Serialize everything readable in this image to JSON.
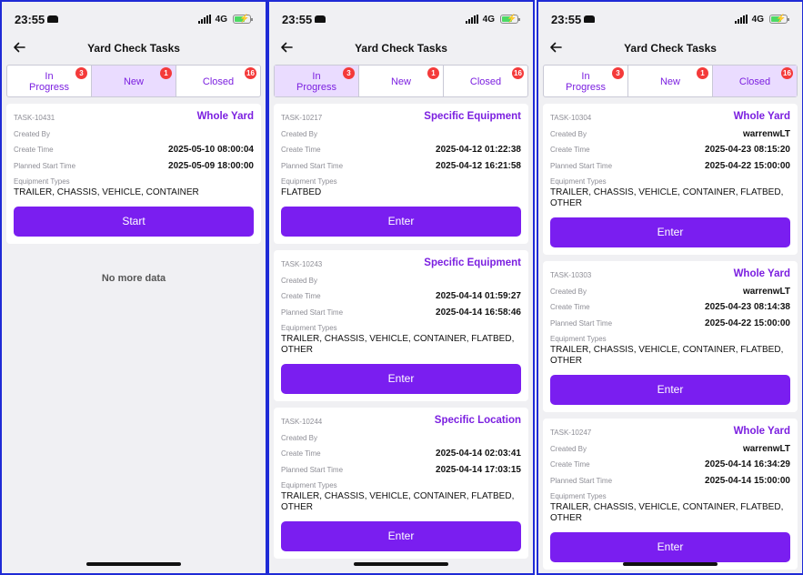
{
  "colors": {
    "accent": "#7a1ef0",
    "badge": "#f43a3a",
    "active_tab_bg": "#eadcff",
    "frame": "#1f2bd6"
  },
  "screens": [
    {
      "status": {
        "time": "23:55",
        "network": "4G"
      },
      "header": {
        "title": "Yard Check Tasks",
        "back_icon": "arrow-left-icon"
      },
      "tabs": [
        {
          "label": "In\nProgress",
          "badge": "3",
          "active": false
        },
        {
          "label": "New",
          "badge": "1",
          "active": true
        },
        {
          "label": "Closed",
          "badge": "16",
          "active": false
        }
      ],
      "tasks": [
        {
          "id": "TASK-10431",
          "kind": "Whole Yard",
          "created_by_label": "Created By",
          "created_by": "",
          "create_time_label": "Create Time",
          "create_time": "2025-05-10 08:00:04",
          "planned_label": "Planned Start Time",
          "planned": "2025-05-09 18:00:00",
          "types_label": "Equipment Types",
          "types": "TRAILER, CHASSIS, VEHICLE, CONTAINER",
          "button": "Start"
        }
      ],
      "footer": "No more data"
    },
    {
      "status": {
        "time": "23:55",
        "network": "4G"
      },
      "header": {
        "title": "Yard Check Tasks",
        "back_icon": "arrow-left-icon"
      },
      "tabs": [
        {
          "label": "In\nProgress",
          "badge": "3",
          "active": true
        },
        {
          "label": "New",
          "badge": "1",
          "active": false
        },
        {
          "label": "Closed",
          "badge": "16",
          "active": false
        }
      ],
      "tasks": [
        {
          "id": "TASK-10217",
          "kind": "Specific Equipment",
          "created_by_label": "Created By",
          "created_by": "",
          "create_time_label": "Create Time",
          "create_time": "2025-04-12 01:22:38",
          "planned_label": "Planned Start Time",
          "planned": "2025-04-12 16:21:58",
          "types_label": "Equipment Types",
          "types": "FLATBED",
          "button": "Enter"
        },
        {
          "id": "TASK-10243",
          "kind": "Specific Equipment",
          "created_by_label": "Created By",
          "created_by": "",
          "create_time_label": "Create Time",
          "create_time": "2025-04-14 01:59:27",
          "planned_label": "Planned Start Time",
          "planned": "2025-04-14 16:58:46",
          "types_label": "Equipment Types",
          "types": "TRAILER, CHASSIS, VEHICLE, CONTAINER, FLATBED, OTHER",
          "button": "Enter"
        },
        {
          "id": "TASK-10244",
          "kind": "Specific Location",
          "created_by_label": "Created By",
          "created_by": "",
          "create_time_label": "Create Time",
          "create_time": "2025-04-14 02:03:41",
          "planned_label": "Planned Start Time",
          "planned": "2025-04-14 17:03:15",
          "types_label": "Equipment Types",
          "types": "TRAILER, CHASSIS, VEHICLE, CONTAINER, FLATBED, OTHER",
          "button": "Enter"
        }
      ],
      "footer": ""
    },
    {
      "status": {
        "time": "23:55",
        "network": "4G"
      },
      "header": {
        "title": "Yard Check Tasks",
        "back_icon": "arrow-left-icon"
      },
      "tabs": [
        {
          "label": "In\nProgress",
          "badge": "3",
          "active": false
        },
        {
          "label": "New",
          "badge": "1",
          "active": false
        },
        {
          "label": "Closed",
          "badge": "16",
          "active": true
        }
      ],
      "tasks": [
        {
          "id": "TASK-10304",
          "kind": "Whole Yard",
          "created_by_label": "Created By",
          "created_by": "warrenwLT",
          "create_time_label": "Create Time",
          "create_time": "2025-04-23 08:15:20",
          "planned_label": "Planned Start Time",
          "planned": "2025-04-22 15:00:00",
          "types_label": "Equipment Types",
          "types": "TRAILER, CHASSIS, VEHICLE, CONTAINER, FLATBED, OTHER",
          "button": "Enter"
        },
        {
          "id": "TASK-10303",
          "kind": "Whole Yard",
          "created_by_label": "Created By",
          "created_by": "warrenwLT",
          "create_time_label": "Create Time",
          "create_time": "2025-04-23 08:14:38",
          "planned_label": "Planned Start Time",
          "planned": "2025-04-22 15:00:00",
          "types_label": "Equipment Types",
          "types": "TRAILER, CHASSIS, VEHICLE, CONTAINER, FLATBED, OTHER",
          "button": "Enter"
        },
        {
          "id": "TASK-10247",
          "kind": "Whole Yard",
          "created_by_label": "Created By",
          "created_by": "warrenwLT",
          "create_time_label": "Create Time",
          "create_time": "2025-04-14 16:34:29",
          "planned_label": "Planned Start Time",
          "planned": "2025-04-14 15:00:00",
          "types_label": "Equipment Types",
          "types": "TRAILER, CHASSIS, VEHICLE, CONTAINER, FLATBED, OTHER",
          "button": "Enter"
        }
      ],
      "footer": ""
    }
  ]
}
